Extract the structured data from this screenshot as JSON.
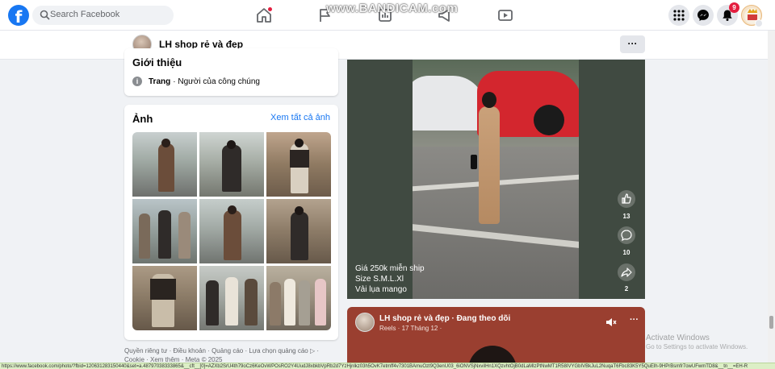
{
  "topbar": {
    "search_placeholder": "Search Facebook",
    "notification_count": "9",
    "recorder_watermark": "www.BANDICAM.com"
  },
  "page_header": {
    "name": "LH shop rẻ và đẹp",
    "more_label": "···"
  },
  "intro": {
    "title": "Giới thiệu",
    "type_label": "Trang",
    "type_value": "· Người của công chúng"
  },
  "photos": {
    "title": "Ảnh",
    "see_all": "Xem tất cả ảnh"
  },
  "footer": {
    "line1": "Quyền riêng tư · Điều khoản · Quảng cáo · Lựa chọn quảng cáo ▷ ·",
    "line2": "Cookie · Xem thêm · Meta © 2025"
  },
  "reel": {
    "caption_lines": [
      "Giá 250k miễn ship",
      "Size S.M.L.Xl",
      "Vải lụa mango"
    ],
    "like_count": "13",
    "comment_count": "10",
    "share_count": "2"
  },
  "post2": {
    "title": "LH shop rẻ và đẹp · Đang theo dõi",
    "meta": "Reels · 17 Tháng 12 ·"
  },
  "windows_activation": {
    "title": "Activate Windows",
    "subtitle": "Go to Settings to activate Windows."
  },
  "status_url": "https://www.facebook.com/photo/?fbid=120631283150440&set=a.48797038333865&__cft__[0]=AZXb2SrU4th79oCz6KeOvWPOsRO2Y4UudJ8xbkbVpRb2d7YzHjnlkz03h5OvK7etmff4v7301BAmuOzt9Q3enU03_6iONVSjNxvilHn1XQzvhtOjB0dLaMlzPtNwMT1R58IVYGbIVBkJuL2NuqaT6Fbc83K5Y5QuElh-9HPrBsmfr7owUFwmTD8&__tn__=EH-R"
}
